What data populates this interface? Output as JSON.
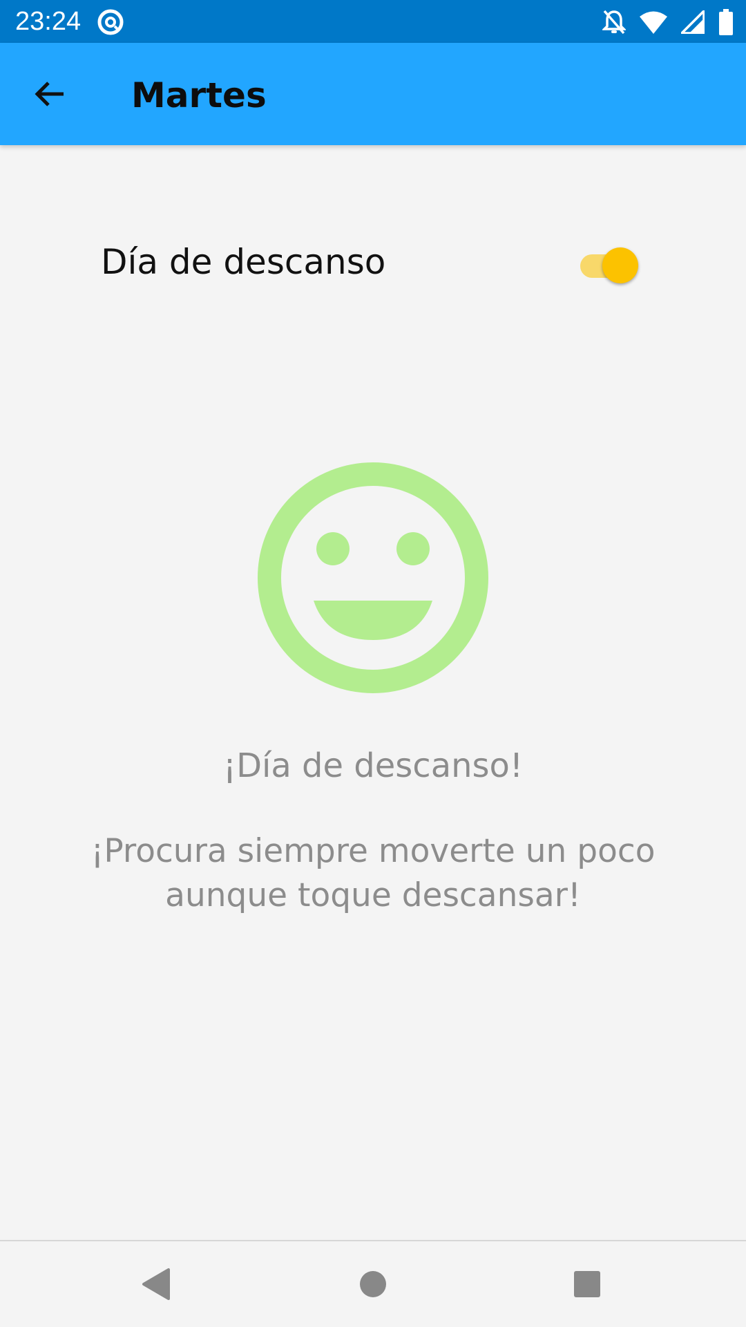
{
  "status_bar": {
    "time": "23:24",
    "icons": [
      "at-sign-icon",
      "notifications-off-icon",
      "wifi-icon",
      "signal-icon",
      "battery-icon"
    ]
  },
  "app_bar": {
    "title": "Martes",
    "back_icon": "arrow-back-icon"
  },
  "rest_day_switch": {
    "label": "Día de descanso",
    "checked": true,
    "colors": {
      "track": "#f8d86a",
      "thumb": "#fcc200"
    }
  },
  "content": {
    "icon": "smiley-face-icon",
    "icon_color": "#b3ed8f",
    "title": "¡Día de descanso!",
    "message": "¡Procura siempre moverte un poco aunque toque descansar!"
  },
  "colors": {
    "status_bar": "#0078c8",
    "app_bar": "#22a6ff",
    "background": "#f4f4f4",
    "text_muted": "#8c8c8c"
  },
  "nav_bar": {
    "buttons": [
      "back-triangle-icon",
      "home-circle-icon",
      "recents-square-icon"
    ]
  }
}
